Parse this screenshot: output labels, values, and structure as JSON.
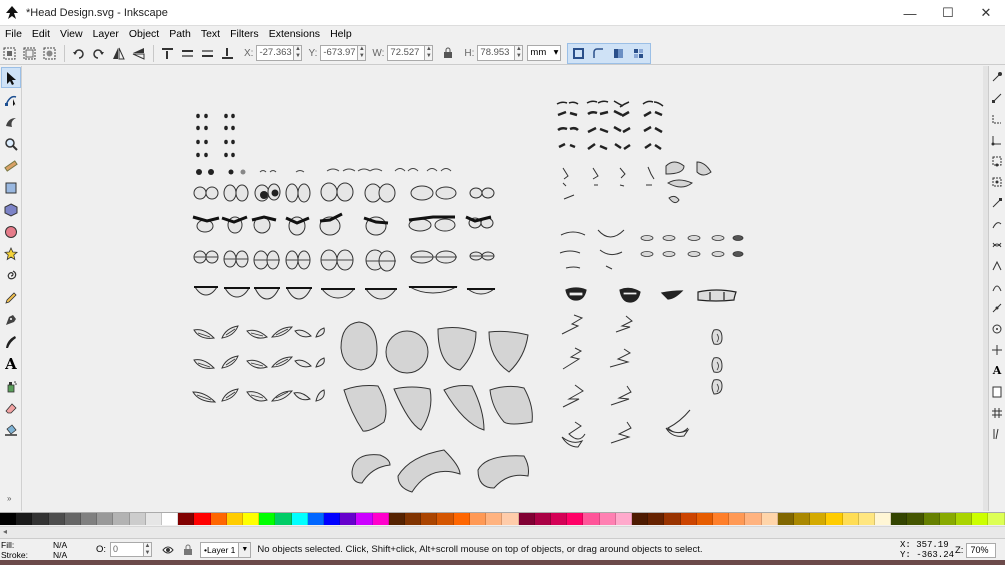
{
  "window": {
    "title": "*Head Design.svg - Inkscape",
    "minimize_icon": "minimize-icon",
    "maximize_icon": "maximize-icon",
    "close_icon": "close-icon"
  },
  "menu": [
    "File",
    "Edit",
    "View",
    "Layer",
    "Object",
    "Path",
    "Text",
    "Filters",
    "Extensions",
    "Help"
  ],
  "toolbar": {
    "x_label": "X:",
    "x_value": "-27.363",
    "y_label": "Y:",
    "y_value": "-673.97",
    "w_label": "W:",
    "w_value": "72.527",
    "h_label": "H:",
    "h_value": "78.953",
    "lock_icon": "lock-icon",
    "unit": "mm"
  },
  "tools": [
    "selector-icon",
    "node-icon",
    "tweak-icon",
    "zoom-icon",
    "measure-icon",
    "rectangle-icon",
    "3d-box-icon",
    "ellipse-icon",
    "star-icon",
    "spiral-icon",
    "pencil-icon",
    "pen-icon",
    "calligraphy-icon",
    "text-icon",
    "spray-icon",
    "eraser-icon",
    "paint-bucket-icon"
  ],
  "palette": [
    "#000000",
    "#1a1a1a",
    "#333333",
    "#4d4d4d",
    "#666666",
    "#808080",
    "#999999",
    "#b3b3b3",
    "#cccccc",
    "#e6e6e6",
    "#ffffff",
    "#800000",
    "#ff0000",
    "#ff6600",
    "#ffcc00",
    "#ffff00",
    "#00ff00",
    "#00cc66",
    "#00ffff",
    "#0066ff",
    "#0000ff",
    "#6600cc",
    "#cc00ff",
    "#ff00cc",
    "#552200",
    "#803300",
    "#aa4400",
    "#d45500",
    "#ff6600",
    "#ff9955",
    "#ffb380",
    "#ffccaa",
    "#800033",
    "#aa0044",
    "#d40055",
    "#ff0066",
    "#ff5599",
    "#ff80b2",
    "#ffaacc",
    "#4d1a00",
    "#662200",
    "#993300",
    "#cc4400",
    "#e65c00",
    "#ff7f2a",
    "#ff9955",
    "#ffb380",
    "#ffd5aa",
    "#806600",
    "#aa8800",
    "#d4aa00",
    "#ffcc00",
    "#ffdd55",
    "#ffe680",
    "#fff6d5",
    "#334400",
    "#445500",
    "#668000",
    "#88aa00",
    "#aad400",
    "#ccff00",
    "#ddff55"
  ],
  "status": {
    "fill_label": "Fill:",
    "fill_value": "N/A",
    "stroke_label": "Stroke:",
    "stroke_value": "N/A",
    "opacity_label": "O:",
    "opacity_value": "0",
    "layer": "•Layer 1",
    "message": "No objects selected. Click, Shift+click, Alt+scroll mouse on top of objects, or drag around objects to select.",
    "cursor_x": "X:  357.19",
    "cursor_y": "Y: -363.24",
    "zoom_label": "Z:",
    "zoom_value": "70%"
  }
}
